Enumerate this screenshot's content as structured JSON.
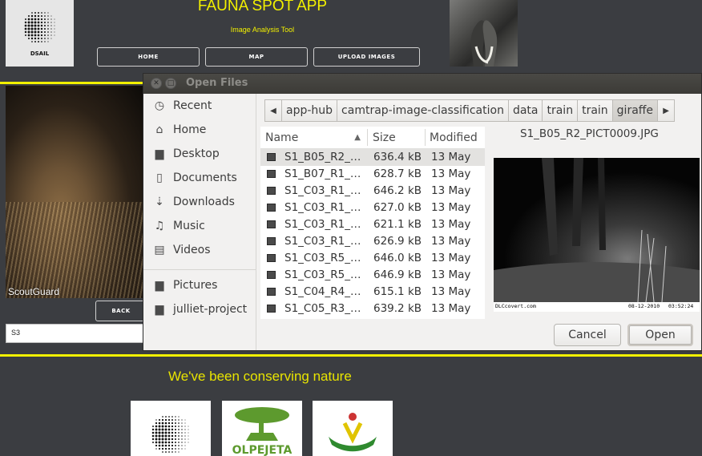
{
  "app": {
    "logo_label": "DSAIL",
    "title": "FAUNA SPOT APP",
    "subtitle": "Image Analysis Tool",
    "nav": [
      "HOME",
      "MAP",
      "UPLOAD IMAGES"
    ],
    "camera_watermark": "ScoutGuard",
    "back_label": "BACK",
    "site_input_value": "S3",
    "conserve_text": "We've been conserving nature",
    "accent_color": "#f2f000",
    "background_color": "#3b3d41"
  },
  "dialog": {
    "title": "Open Files",
    "places": [
      {
        "icon": "clock-icon",
        "label": "Recent"
      },
      {
        "icon": "home-icon",
        "label": "Home"
      },
      {
        "icon": "folder-icon",
        "label": "Desktop"
      },
      {
        "icon": "document-icon",
        "label": "Documents"
      },
      {
        "icon": "download-icon",
        "label": "Downloads"
      },
      {
        "icon": "music-icon",
        "label": "Music"
      },
      {
        "icon": "video-icon",
        "label": "Videos"
      },
      {
        "icon": "folder-icon",
        "label": "Pictures"
      },
      {
        "icon": "folder-icon",
        "label": "julliet-project"
      }
    ],
    "path": [
      "app-hub",
      "camtrap-image-classification",
      "data",
      "train",
      "train",
      "giraffe"
    ],
    "columns": {
      "name": "Name",
      "size": "Size",
      "modified": "Modified"
    },
    "files": [
      {
        "name": "S1_B05_R2_…",
        "size": "636.4 kB",
        "modified": "13 May"
      },
      {
        "name": "S1_B07_R1_…",
        "size": "628.7 kB",
        "modified": "13 May"
      },
      {
        "name": "S1_C03_R1_…",
        "size": "646.2 kB",
        "modified": "13 May"
      },
      {
        "name": "S1_C03_R1_…",
        "size": "627.0 kB",
        "modified": "13 May"
      },
      {
        "name": "S1_C03_R1_…",
        "size": "621.1 kB",
        "modified": "13 May"
      },
      {
        "name": "S1_C03_R1_…",
        "size": "626.9 kB",
        "modified": "13 May"
      },
      {
        "name": "S1_C03_R5_…",
        "size": "646.0 kB",
        "modified": "13 May"
      },
      {
        "name": "S1_C03_R5_…",
        "size": "646.9 kB",
        "modified": "13 May"
      },
      {
        "name": "S1_C04_R4_…",
        "size": "615.1 kB",
        "modified": "13 May"
      },
      {
        "name": "S1_C05_R3_…",
        "size": "639.2 kB",
        "modified": "13 May"
      }
    ],
    "preview": {
      "filename": "S1_B05_R2_PICT0009.JPG",
      "brand": "DLCcovert.com",
      "date": "08-12-2010",
      "time": "03:52:24"
    },
    "cancel_label": "Cancel",
    "open_label": "Open"
  }
}
